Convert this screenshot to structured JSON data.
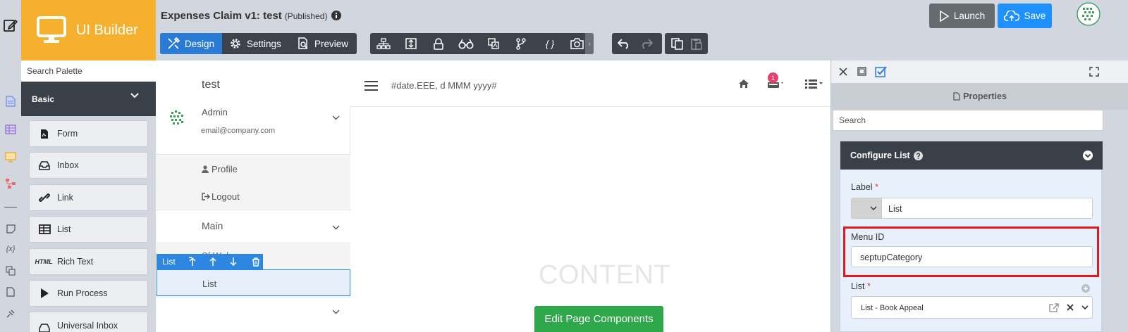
{
  "brand": {
    "title": "UI Builder"
  },
  "palette": {
    "search_placeholder": "Search Palette",
    "category": "Basic",
    "items": [
      {
        "label": "Form",
        "icon": "form-icon"
      },
      {
        "label": "Inbox",
        "icon": "inbox-icon"
      },
      {
        "label": "Link",
        "icon": "link-icon"
      },
      {
        "label": "List",
        "icon": "table-icon"
      },
      {
        "label": "Rich Text",
        "icon": "html-icon",
        "icon_text": "HTML"
      },
      {
        "label": "Run Process",
        "icon": "play-icon"
      },
      {
        "label": "Universal Inbox",
        "icon": "inbox-icon"
      }
    ]
  },
  "header": {
    "title": "Expenses Claim v1: test",
    "status": "(Published)",
    "modes": {
      "design": "Design",
      "settings": "Settings",
      "preview": "Preview"
    },
    "launch": "Launch",
    "save": "Save",
    "brace_tool": "{ }"
  },
  "canvas": {
    "app_name": "test",
    "user_name": "Admin",
    "user_email": "email@company.com",
    "profile": "Profile",
    "logout": "Logout",
    "main_category": "Main",
    "hidden_item": "Sf Web",
    "selected_toolbar_label": "List",
    "selected_item": "List",
    "date_format": "#date.EEE, d MMM yyyy#",
    "notification_count": "1",
    "content_placeholder": "CONTENT",
    "edit_button": "Edit Page Components"
  },
  "properties": {
    "title": "Properties",
    "search_placeholder": "Search",
    "section_title": "Configure List",
    "label_field": {
      "label": "Label",
      "required": "*",
      "value": "List"
    },
    "menu_id_field": {
      "label": "Menu ID",
      "value": "septupCategory"
    },
    "list_field": {
      "label": "List",
      "required": "*",
      "value": "List - Book Appeal"
    }
  },
  "colors": {
    "brand": "#f5b02e",
    "accent": "#2a7bd5",
    "save": "#1e90ff",
    "highlight": "#e0191f",
    "edit_button": "#2ea84a"
  }
}
